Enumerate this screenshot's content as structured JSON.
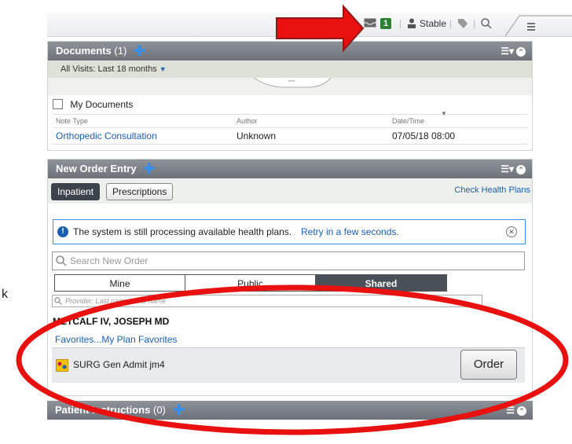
{
  "topbar": {
    "badge_count": "1",
    "status_label": "Stable"
  },
  "documents": {
    "title": "Documents",
    "count": "(1)",
    "filter_label": "All Visits: Last 18 months",
    "my_documents_label": "My Documents",
    "columns": [
      "Note Type",
      "Author",
      "Date/Time"
    ],
    "rows": [
      {
        "note_type": "Orthopedic Consultation",
        "author": "Unknown",
        "datetime": "07/05/18 08:00"
      }
    ]
  },
  "order_entry": {
    "title": "New Order Entry",
    "tabs": [
      {
        "label": "Inpatient",
        "selected": true
      },
      {
        "label": "Prescriptions",
        "selected": false
      }
    ],
    "check_health_plans": "Check Health Plans",
    "info_text": "The system is still processing available health plans.",
    "info_link": "Retry in a few seconds.",
    "search_placeholder": "Search New Order",
    "segments": [
      "Mine",
      "Public",
      "Shared"
    ],
    "provider_placeholder": "Provider: Last name, First name",
    "provider_name": "METCALF IV, JOSEPH MD",
    "favorites_path": "Favorites...My Plan Favorites",
    "order_item": "SURG Gen Admit jm4",
    "order_button": "Order"
  },
  "instructions": {
    "title": "Patient Instructions",
    "count": "(0)"
  },
  "side_text": "k",
  "colors": {
    "header": "#6d727a",
    "link": "#1a5fb4",
    "selected_tab": "#3d434b",
    "annotation": "#e8110f"
  }
}
